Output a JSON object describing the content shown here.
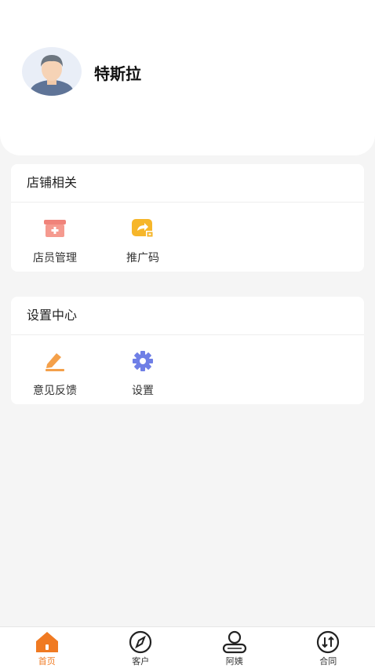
{
  "profile": {
    "name": "特斯拉"
  },
  "sections": [
    {
      "title": "店铺相关",
      "items": [
        {
          "label": "店员管理",
          "icon": "store-icon",
          "color": "#f0837a"
        },
        {
          "label": "推广码",
          "icon": "share-qr-icon",
          "color": "#f6b62a"
        }
      ]
    },
    {
      "title": "设置中心",
      "items": [
        {
          "label": "意见反馈",
          "icon": "edit-icon",
          "color": "#f4a04a"
        },
        {
          "label": "设置",
          "icon": "gear-icon",
          "color": "#6f7fe6"
        }
      ]
    }
  ],
  "tabbar": {
    "active_color": "#f07a22",
    "items": [
      {
        "label": "首页",
        "icon": "home-icon",
        "active": true
      },
      {
        "label": "客户",
        "icon": "compass-icon",
        "active": false
      },
      {
        "label": "阿姨",
        "icon": "person-icon",
        "active": false
      },
      {
        "label": "合同",
        "icon": "swap-icon",
        "active": false
      }
    ]
  }
}
